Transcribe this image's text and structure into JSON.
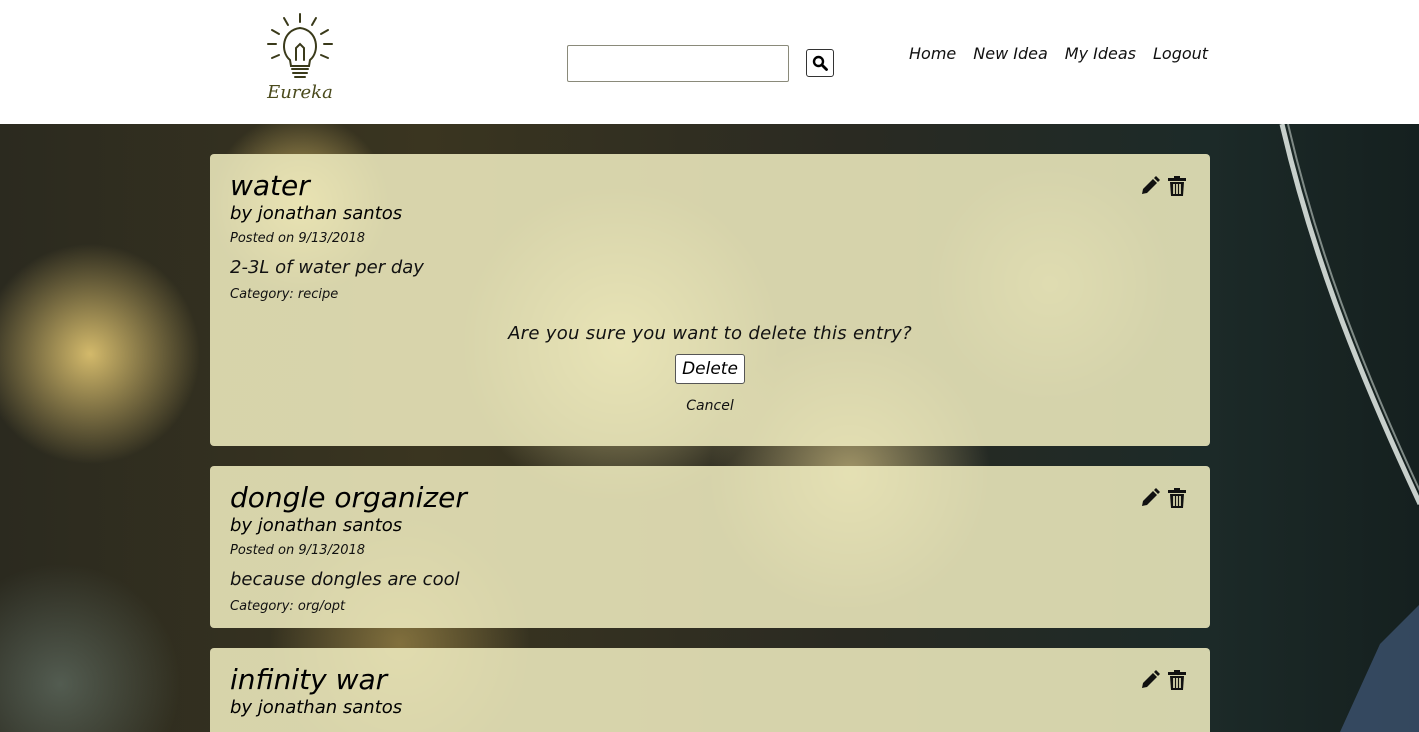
{
  "header": {
    "logo_text": "Eureka",
    "search_placeholder": "",
    "nav": [
      "Home",
      "New Idea",
      "My Ideas",
      "Logout"
    ]
  },
  "ideas": [
    {
      "title": "water",
      "author": "by jonathan santos",
      "date": "Posted on 9/13/2018",
      "body": "2-3L of water per day",
      "category": "Category: recipe",
      "confirm": {
        "message": "Are you sure you want to delete this entry?",
        "delete_label": "Delete",
        "cancel_label": "Cancel"
      }
    },
    {
      "title": "dongle organizer",
      "author": "by jonathan santos",
      "date": "Posted on 9/13/2018",
      "body": "because dongles are cool",
      "category": "Category: org/opt"
    },
    {
      "title": "infinity war",
      "author": "by jonathan santos"
    }
  ],
  "icons": {
    "search": "search-icon",
    "edit": "pencil-icon",
    "delete": "trash-icon",
    "logo": "lightbulb-icon"
  }
}
